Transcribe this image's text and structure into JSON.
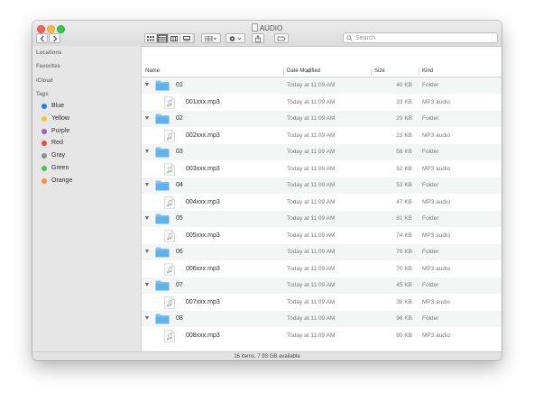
{
  "window": {
    "title": "AUDIO"
  },
  "search": {
    "placeholder": "Search"
  },
  "sidebar": {
    "headings": [
      "Locations",
      "Favorites",
      "iCloud",
      "Tags"
    ],
    "tags": [
      {
        "label": "Blue",
        "color": "#1f7ff0"
      },
      {
        "label": "Yellow",
        "color": "#f3c33b"
      },
      {
        "label": "Purple",
        "color": "#a05bd4"
      },
      {
        "label": "Red",
        "color": "#ec4942"
      },
      {
        "label": "Gray",
        "color": "#8e8e93"
      },
      {
        "label": "Green",
        "color": "#4cc04c"
      },
      {
        "label": "Orange",
        "color": "#f7902e"
      }
    ]
  },
  "columns": {
    "name": "Name",
    "date": "Date Modified",
    "size": "Size",
    "kind": "Kind"
  },
  "rows": [
    {
      "type": "folder",
      "name": "01",
      "date": "Today at 11:09 AM",
      "size": "40 KB",
      "kind": "Folder"
    },
    {
      "type": "file",
      "name": "001xxx.mp3",
      "date": "Today at 11:09 AM",
      "size": "33 KB",
      "kind": "MP3 audio"
    },
    {
      "type": "folder",
      "name": "02",
      "date": "Today at 11:09 AM",
      "size": "29 KB",
      "kind": "Folder"
    },
    {
      "type": "file",
      "name": "002xxx.mp3",
      "date": "Today at 11:09 AM",
      "size": "23 KB",
      "kind": "MP3 audio"
    },
    {
      "type": "folder",
      "name": "03",
      "date": "Today at 11:09 AM",
      "size": "58 KB",
      "kind": "Folder"
    },
    {
      "type": "file",
      "name": "003xxx.mp3",
      "date": "Today at 11:09 AM",
      "size": "52 KB",
      "kind": "MP3 audio"
    },
    {
      "type": "folder",
      "name": "04",
      "date": "Today at 11:09 AM",
      "size": "53 KB",
      "kind": "Folder"
    },
    {
      "type": "file",
      "name": "004xxx.mp3",
      "date": "Today at 11:09 AM",
      "size": "47 KB",
      "kind": "MP3 audio"
    },
    {
      "type": "folder",
      "name": "05",
      "date": "Today at 11:09 AM",
      "size": "81 KB",
      "kind": "Folder"
    },
    {
      "type": "file",
      "name": "005xxx.mp3",
      "date": "Today at 11:09 AM",
      "size": "74 KB",
      "kind": "MP3 audio"
    },
    {
      "type": "folder",
      "name": "06",
      "date": "Today at 11:09 AM",
      "size": "76 KB",
      "kind": "Folder"
    },
    {
      "type": "file",
      "name": "006xxx.mp3",
      "date": "Today at 11:09 AM",
      "size": "70 KB",
      "kind": "MP3 audio"
    },
    {
      "type": "folder",
      "name": "07",
      "date": "Today at 11:09 AM",
      "size": "45 KB",
      "kind": "Folder"
    },
    {
      "type": "file",
      "name": "007xxx.mp3",
      "date": "Today at 11:09 AM",
      "size": "38 KB",
      "kind": "MP3 audio"
    },
    {
      "type": "folder",
      "name": "08",
      "date": "Today at 11:09 AM",
      "size": "96 KB",
      "kind": "Folder"
    },
    {
      "type": "file",
      "name": "008xxx.mp3",
      "date": "Today at 11:09 AM",
      "size": "90 KB",
      "kind": "MP3 audio"
    }
  ],
  "status": {
    "text": "16 items, 7.93 GB available"
  }
}
